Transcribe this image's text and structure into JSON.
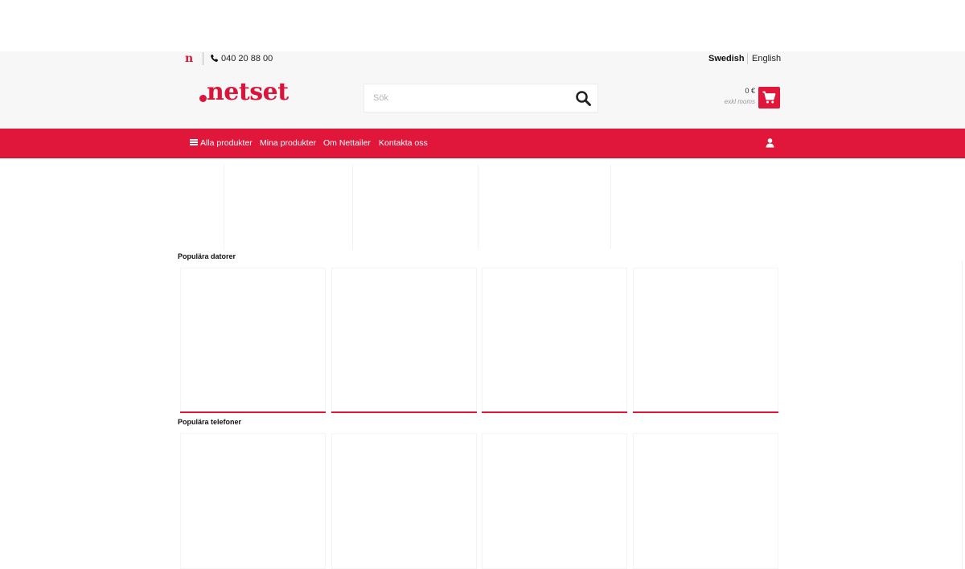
{
  "brand": {
    "name": "netset",
    "mini_logo": "n",
    "accent_color": "#e0163b"
  },
  "topbar": {
    "phone_icon": "phone-icon",
    "phone": "040 20 88 00",
    "languages": {
      "active": "Swedish",
      "other": "English"
    }
  },
  "search": {
    "placeholder": "Sök",
    "icon": "search-icon"
  },
  "cart": {
    "total": "0 €",
    "vat_note": "exkl moms",
    "icon": "cart-icon"
  },
  "nav": {
    "menu_icon": "hamburger-menu-icon",
    "items": [
      "Alla produkter",
      "Mina produkter",
      "Om Nettailer",
      "Kontakta oss"
    ],
    "account_icon": "user-icon"
  },
  "sections": [
    {
      "title": "Populära datorer",
      "card_count": 4
    },
    {
      "title": "Populära telefoner",
      "card_count": 4
    }
  ]
}
